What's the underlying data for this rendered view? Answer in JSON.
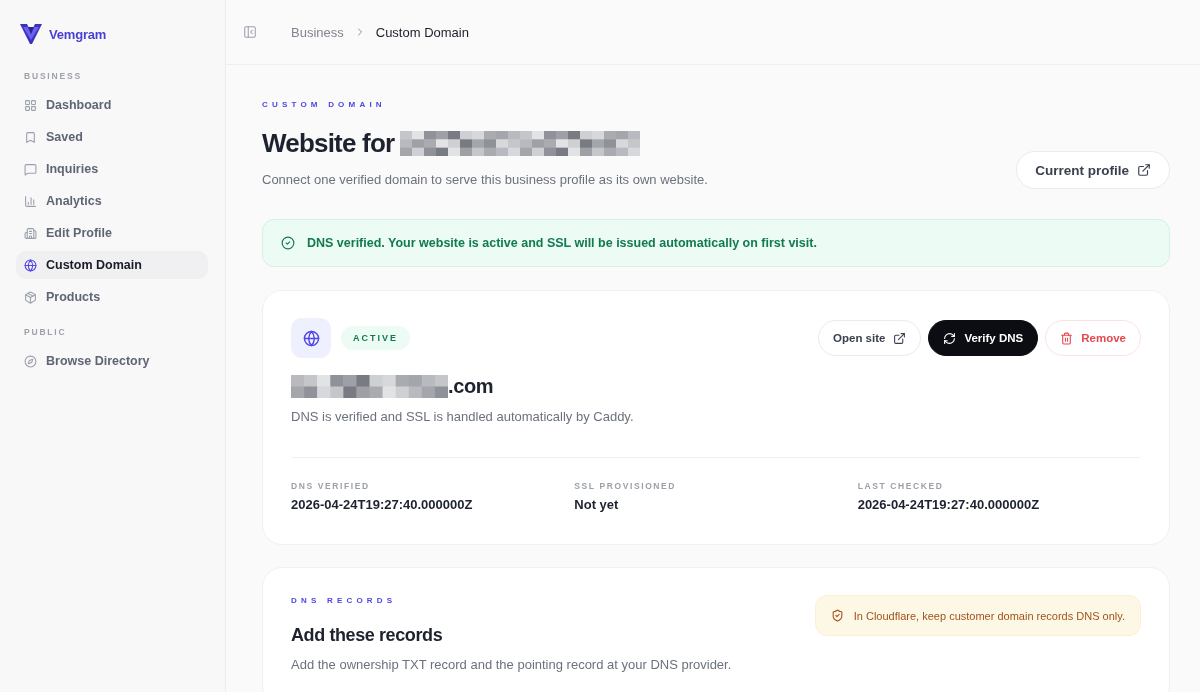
{
  "sidebar": {
    "brand": "Vemgram",
    "sections": [
      {
        "label": "BUSINESS",
        "items": [
          {
            "label": "Dashboard",
            "selected": false
          },
          {
            "label": "Saved",
            "selected": false
          },
          {
            "label": "Inquiries",
            "selected": false
          },
          {
            "label": "Analytics",
            "selected": false
          },
          {
            "label": "Edit Profile",
            "selected": false
          },
          {
            "label": "Custom Domain",
            "selected": true
          },
          {
            "label": "Products",
            "selected": false
          }
        ]
      },
      {
        "label": "PUBLIC",
        "items": [
          {
            "label": "Browse Directory",
            "selected": false
          }
        ]
      }
    ]
  },
  "topbar": {
    "breadcrumb": [
      {
        "label": "Business",
        "current": false
      },
      {
        "label": "Custom Domain",
        "current": true
      }
    ]
  },
  "header": {
    "eyebrow": "CUSTOM DOMAIN",
    "title": "Website for",
    "subtitle": "Connect one verified domain to serve this business profile as its own website.",
    "action": "Current profile"
  },
  "alert": {
    "kind": "success",
    "text": "DNS verified. Your website is active and SSL will be issued automatically on first visit."
  },
  "domain_card": {
    "status": {
      "label": "ACTIVE",
      "kind": "active"
    },
    "actions": [
      {
        "label": "Open site",
        "kind": "outline"
      },
      {
        "label": "Verify DNS",
        "kind": "primary"
      },
      {
        "label": "Remove",
        "kind": "danger"
      }
    ],
    "domain_suffix": ".com",
    "description": "DNS is verified and SSL is handled automatically by Caddy.",
    "details": [
      {
        "label": "DNS VERIFIED",
        "value": "2026-04-24T19:27:40.000000Z"
      },
      {
        "label": "SSL PROVISIONED",
        "value": "Not yet"
      },
      {
        "label": "LAST CHECKED",
        "value": "2026-04-24T19:27:40.000000Z"
      }
    ]
  },
  "records_card": {
    "eyebrow": "DNS RECORDS",
    "title": "Add these records",
    "description": "Add the ownership TXT record and the pointing record at your DNS provider.",
    "notice": {
      "kind": "warning",
      "text": "In Cloudflare, keep customer domain records DNS only."
    }
  }
}
